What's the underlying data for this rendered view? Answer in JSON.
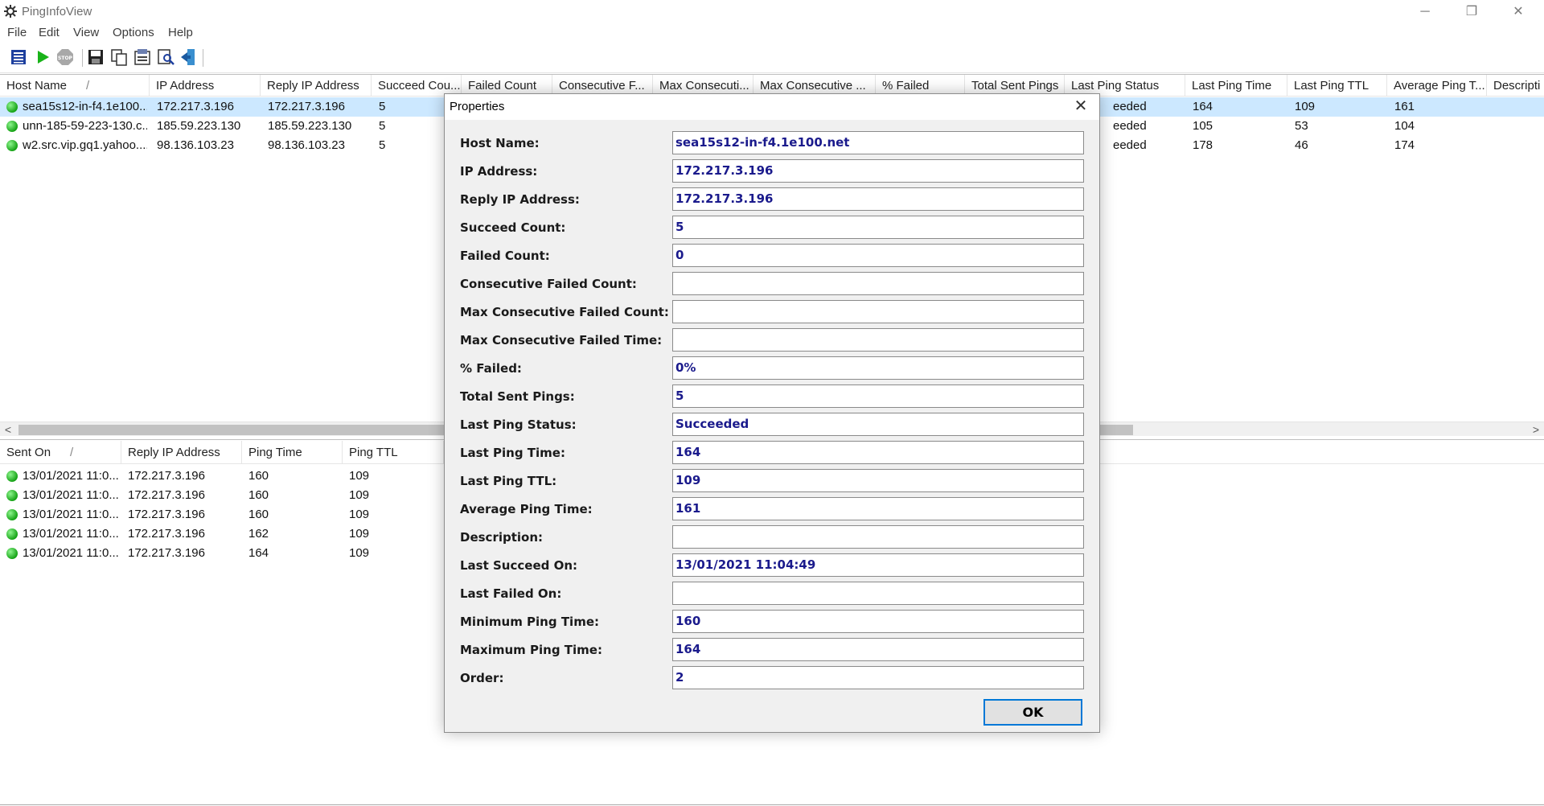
{
  "window": {
    "title": "PingInfoView",
    "min_glyph": "─",
    "max_glyph": "❐",
    "close_glyph": "✕"
  },
  "menu": [
    "File",
    "Edit",
    "View",
    "Options",
    "Help"
  ],
  "toolbar_icons": [
    "properties-icon",
    "start-icon",
    "stop-icon",
    "save-icon",
    "copy-icon",
    "html-report-icon",
    "find-icon",
    "exit-icon"
  ],
  "hosts_table": {
    "columns": [
      "Host Name",
      "IP Address",
      "Reply IP Address",
      "Succeed Cou...",
      "Failed Count",
      "Consecutive F...",
      "Max Consecuti...",
      "Max Consecutive ...",
      "% Failed",
      "Total Sent Pings",
      "Last Ping Status",
      "Last Ping Time",
      "Last Ping TTL",
      "Average Ping T...",
      "Descripti"
    ],
    "sort_glyph": "/",
    "rows": [
      {
        "host": "sea15s12-in-f4.1e100....",
        "ip": "172.217.3.196",
        "reply_ip": "172.217.3.196",
        "succeed": "5",
        "status": "eeded",
        "last_time": "164",
        "ttl": "109",
        "avg": "161"
      },
      {
        "host": "unn-185-59-223-130.c...",
        "ip": "185.59.223.130",
        "reply_ip": "185.59.223.130",
        "succeed": "5",
        "status": "eeded",
        "last_time": "105",
        "ttl": "53",
        "avg": "104"
      },
      {
        "host": "w2.src.vip.gq1.yahoo....",
        "ip": "98.136.103.23",
        "reply_ip": "98.136.103.23",
        "succeed": "5",
        "status": "eeded",
        "last_time": "178",
        "ttl": "46",
        "avg": "174"
      }
    ]
  },
  "pings_table": {
    "columns": [
      "Sent On",
      "Reply IP Address",
      "Ping Time",
      "Ping TTL"
    ],
    "sort_glyph": "/",
    "rows": [
      {
        "sent": "13/01/2021 11:0...",
        "reply_ip": "172.217.3.196",
        "time": "160",
        "ttl": "109"
      },
      {
        "sent": "13/01/2021 11:0...",
        "reply_ip": "172.217.3.196",
        "time": "160",
        "ttl": "109"
      },
      {
        "sent": "13/01/2021 11:0...",
        "reply_ip": "172.217.3.196",
        "time": "160",
        "ttl": "109"
      },
      {
        "sent": "13/01/2021 11:0...",
        "reply_ip": "172.217.3.196",
        "time": "162",
        "ttl": "109"
      },
      {
        "sent": "13/01/2021 11:0...",
        "reply_ip": "172.217.3.196",
        "time": "164",
        "ttl": "109"
      }
    ]
  },
  "scrollbar": {
    "left_arrow": "<",
    "right_arrow": ">"
  },
  "dialog": {
    "title": "Properties",
    "close_glyph": "✕",
    "fields": [
      {
        "label": "Host Name:",
        "value": "sea15s12-in-f4.1e100.net"
      },
      {
        "label": "IP Address:",
        "value": "172.217.3.196"
      },
      {
        "label": "Reply IP Address:",
        "value": "172.217.3.196"
      },
      {
        "label": "Succeed Count:",
        "value": "5"
      },
      {
        "label": "Failed Count:",
        "value": "0"
      },
      {
        "label": "Consecutive Failed Count:",
        "value": ""
      },
      {
        "label": "Max Consecutive Failed Count:",
        "value": ""
      },
      {
        "label": "Max Consecutive Failed Time:",
        "value": ""
      },
      {
        "label": "% Failed:",
        "value": "0%"
      },
      {
        "label": "Total Sent Pings:",
        "value": "5"
      },
      {
        "label": "Last Ping Status:",
        "value": "Succeeded"
      },
      {
        "label": "Last Ping Time:",
        "value": "164"
      },
      {
        "label": "Last Ping TTL:",
        "value": "109"
      },
      {
        "label": "Average Ping Time:",
        "value": "161"
      },
      {
        "label": "Description:",
        "value": ""
      },
      {
        "label": "Last Succeed On:",
        "value": "13/01/2021 11:04:49"
      },
      {
        "label": "Last Failed On:",
        "value": ""
      },
      {
        "label": "Minimum Ping Time:",
        "value": "160"
      },
      {
        "label": "Maximum Ping Time:",
        "value": "164"
      },
      {
        "label": "Order:",
        "value": "2"
      }
    ],
    "ok_label": "OK"
  }
}
